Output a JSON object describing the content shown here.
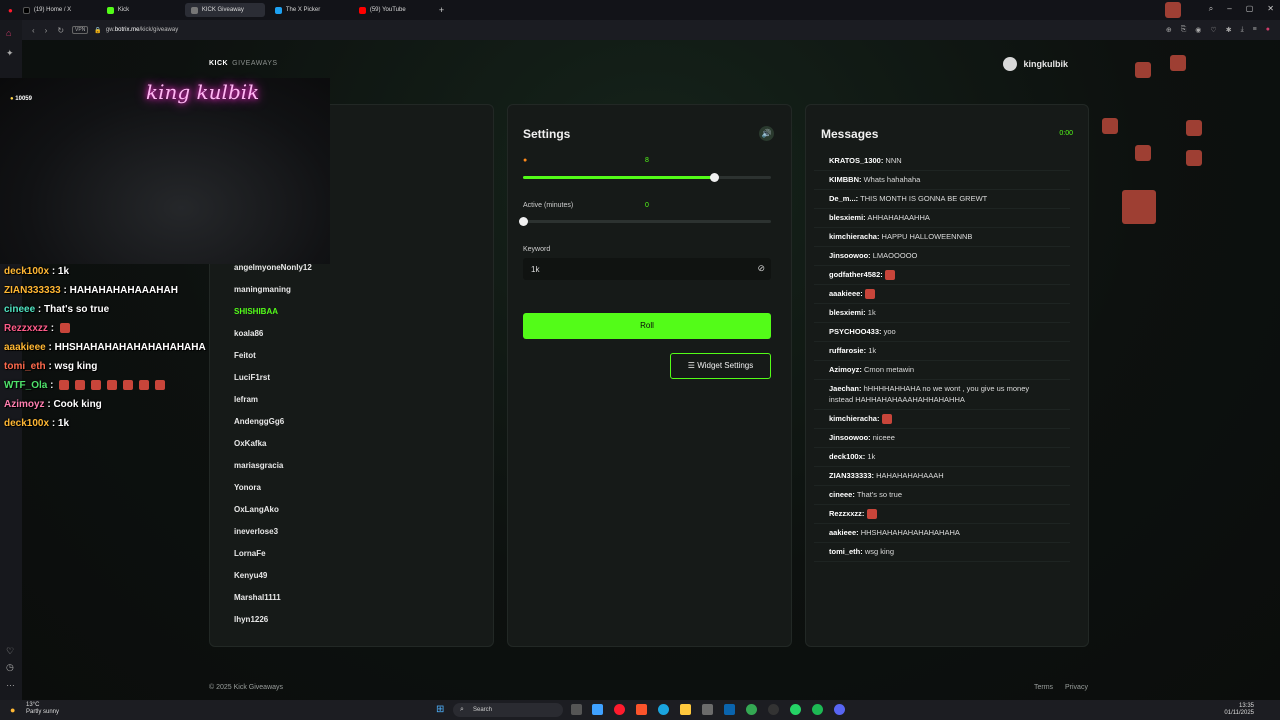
{
  "browser": {
    "tabs": [
      {
        "title": "(19) Home / X",
        "color": "#000000"
      },
      {
        "title": "Kick",
        "color": "#53fc18"
      },
      {
        "title": "KICK Giveaway",
        "color": "#4a4a4a"
      },
      {
        "title": "The X Picker",
        "color": "#1da1f2"
      },
      {
        "title": "(59) YouTube",
        "color": "#ff0000"
      }
    ],
    "url_prefix": "gw.",
    "url_domain": "botrix.me",
    "url_path": "/kick/giveaway",
    "vpn": "VPN"
  },
  "header": {
    "brand": "KICK",
    "brand_sub": "GIVEAWAYS",
    "username": "kingkulbik"
  },
  "participants": [
    "angelmyoneNonly12",
    "maningmaning",
    "SHISHIBAA",
    "koala86",
    "Feitot",
    "LuciF1rst",
    "lefram",
    "AndenggGg6",
    "OxKafka",
    "mariasgracia",
    "Yonora",
    "OxLangAko",
    "ineverlose3",
    "LornaFe",
    "Kenyu49",
    "Marshal1111",
    "lhyn1226"
  ],
  "settings": {
    "title": "Settings",
    "slider1_value": "8",
    "slider1_fraction": 0.77,
    "active_label": "Active (minutes)",
    "active_value": "0",
    "active_fraction": 0.0,
    "keyword_label": "Keyword",
    "keyword_value": "1k",
    "roll_label": "Roll",
    "widget_label": "Widget Settings"
  },
  "messages": {
    "title": "Messages",
    "timer": "0:00",
    "items": [
      {
        "user": "KRATOS_1300:",
        "text": "NNN"
      },
      {
        "user": "KIMBBN:",
        "text": "Whats hahahaha"
      },
      {
        "user": "De_m...:",
        "text": "THIS MONTH IS GONNA BE GREWT"
      },
      {
        "user": "blesxiemi:",
        "text": "AHHAHAHAAHHA"
      },
      {
        "user": "kimchieracha:",
        "text": "HAPPU HALLOWEENNNB"
      },
      {
        "user": "Jinsoowoo:",
        "text": "LMAOOOOO"
      },
      {
        "user": "godfather4582:",
        "text": ""
      },
      {
        "user": "aaakieee:",
        "text": ""
      },
      {
        "user": "blesxiemi:",
        "text": "1k"
      },
      {
        "user": "PSYCHOO433:",
        "text": "yoo"
      },
      {
        "user": "ruffarosie:",
        "text": "1k"
      },
      {
        "user": "Azimoyz:",
        "text": "Cmon metawin"
      },
      {
        "user": "Jaechan:",
        "text": "hHHHHAHHAHA no we wont , you give us money instead HAHHAHAHAAAHAHHAHAHHA"
      },
      {
        "user": "kimchieracha:",
        "text": ""
      },
      {
        "user": "Jinsoowoo:",
        "text": "niceee"
      },
      {
        "user": "deck100x:",
        "text": "1k"
      },
      {
        "user": "ZIAN333333:",
        "text": "HAHAHAHAHAAAH"
      },
      {
        "user": "cineee:",
        "text": "That's so true"
      },
      {
        "user": "Rezzxxzz:",
        "text": ""
      },
      {
        "user": "aakieee:",
        "text": "HHSHAHAHAHAHAHAHAHA"
      },
      {
        "user": "tomi_eth:",
        "text": "wsg king"
      }
    ]
  },
  "stream": {
    "neon": "king kulbik",
    "viewers": "10059",
    "chat": [
      {
        "user": "deck100x",
        "text": ": 1k"
      },
      {
        "user": "ZIAN333333",
        "text": ": HAHAHAHAHAAAHAH"
      },
      {
        "user": "cineee",
        "text": ": That's so true"
      },
      {
        "user": "Rezzxxzz",
        "text": ":"
      },
      {
        "user": "aaakieee",
        "text": ": HHSHAHAHAHAHAHAHAHAHA"
      },
      {
        "user": "tomi_eth",
        "text": ": wsg king"
      },
      {
        "user": "WTF_Ola",
        "text": ":"
      },
      {
        "user": "Azimoyz",
        "text": ": Cook king"
      },
      {
        "user": "deck100x",
        "text": ": 1k"
      }
    ]
  },
  "footer": {
    "copyright": "© 2025 Kick Giveaways",
    "terms": "Terms",
    "privacy": "Privacy"
  },
  "taskbar": {
    "temp": "13°C",
    "weather": "Partly sunny",
    "search": "Search",
    "time": "13:35",
    "date": "01/11/2025"
  }
}
